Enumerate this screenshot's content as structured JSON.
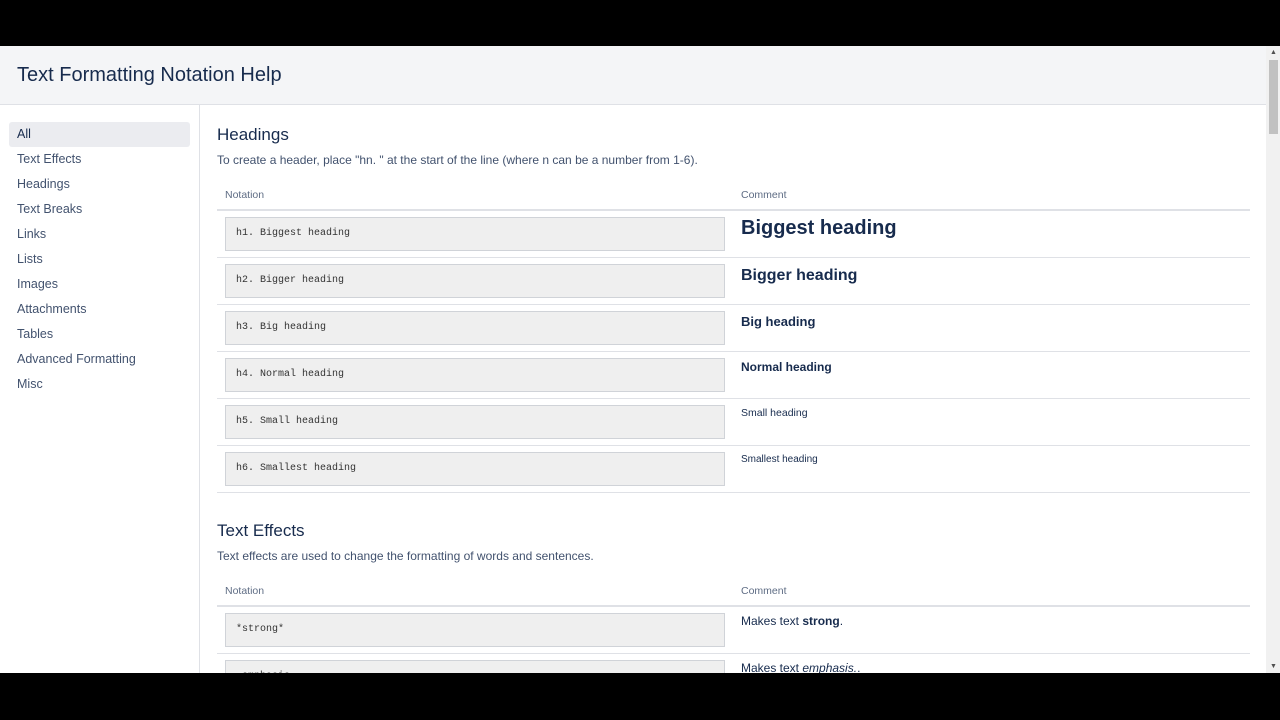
{
  "header": {
    "title": "Text Formatting Notation Help"
  },
  "sidebar": {
    "items": [
      {
        "label": "All",
        "active": true
      },
      {
        "label": "Text Effects"
      },
      {
        "label": "Headings"
      },
      {
        "label": "Text Breaks"
      },
      {
        "label": "Links"
      },
      {
        "label": "Lists"
      },
      {
        "label": "Images"
      },
      {
        "label": "Attachments"
      },
      {
        "label": "Tables"
      },
      {
        "label": "Advanced Formatting"
      },
      {
        "label": "Misc"
      }
    ]
  },
  "sections": {
    "headings": {
      "title": "Headings",
      "description": "To create a header, place \"hn. \" at the start of the line (where n can be a number from 1-6).",
      "col_notation": "Notation",
      "col_comment": "Comment",
      "rows": [
        {
          "notation": "h1. Biggest heading",
          "comment": "Biggest heading"
        },
        {
          "notation": "h2. Bigger heading",
          "comment": "Bigger heading"
        },
        {
          "notation": "h3. Big heading",
          "comment": "Big heading"
        },
        {
          "notation": "h4. Normal heading",
          "comment": "Normal heading"
        },
        {
          "notation": "h5. Small heading",
          "comment": "Small heading"
        },
        {
          "notation": "h6. Smallest heading",
          "comment": "Smallest heading"
        }
      ]
    },
    "text_effects": {
      "title": "Text Effects",
      "description": "Text effects are used to change the formatting of words and sentences.",
      "col_notation": "Notation",
      "col_comment": "Comment",
      "rows": [
        {
          "notation": "*strong*",
          "comment_prefix": "Makes text ",
          "comment_emph": "strong",
          "comment_suffix": "."
        },
        {
          "notation": "_emphasis_",
          "comment_prefix": "Makes text ",
          "comment_emph": "emphasis.",
          "comment_suffix": "."
        }
      ]
    }
  },
  "colors": {
    "text": "#172b4d",
    "muted": "#42526e",
    "border": "#dfe1e6",
    "code_bg": "#efefef",
    "header_bg": "#f4f5f7"
  }
}
